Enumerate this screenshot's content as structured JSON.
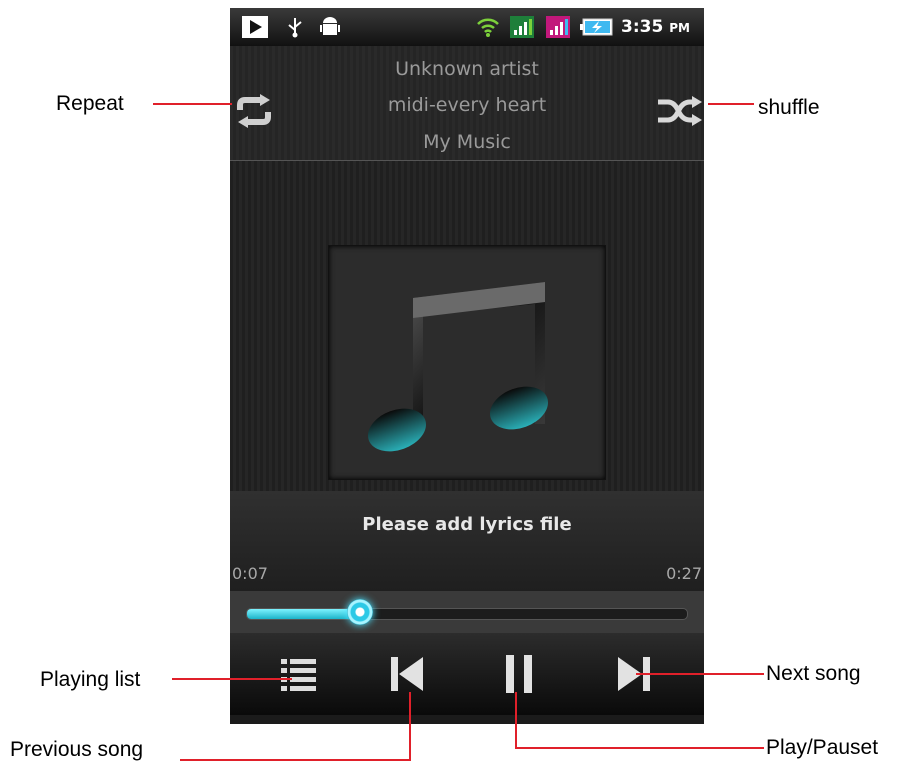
{
  "statusbar": {
    "time": "3:35",
    "ampm": "PM"
  },
  "header": {
    "artist": "Unknown artist",
    "song": "midi-every heart",
    "album": "My Music"
  },
  "lyrics": {
    "message": "Please add lyrics file"
  },
  "progress": {
    "current": "0:07",
    "total": "0:27",
    "fraction": 0.26
  },
  "accent_color": "#2bc9e6",
  "icons": [
    "play-store-icon",
    "usb-icon",
    "android-debug-icon",
    "wifi-icon",
    "signal-icon",
    "signal-roaming-icon",
    "battery-icon",
    "repeat-icon",
    "shuffle-icon",
    "music-note-icon",
    "playing-list-icon",
    "previous-icon",
    "pause-icon",
    "next-icon"
  ],
  "callouts": {
    "repeat": "Repeat",
    "shuffle": "shuffle",
    "playing_list": "Playing list",
    "previous": "Previous song",
    "next": "Next song",
    "play_pause": "Play/Pauset"
  }
}
